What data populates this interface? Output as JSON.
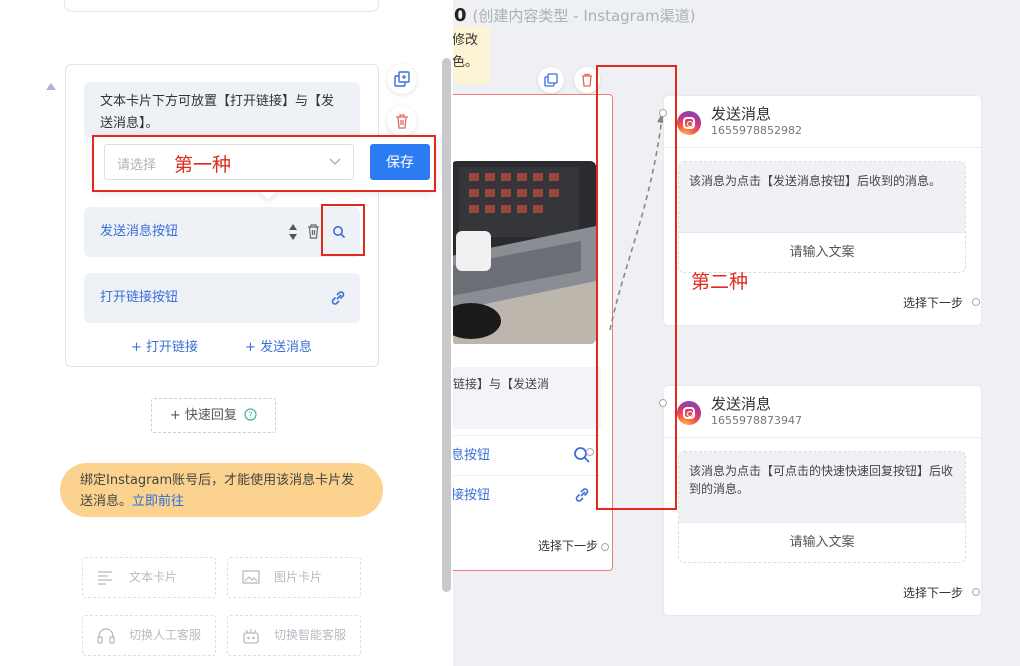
{
  "canvas": {
    "flow_number": "0",
    "flow_subtitle": "(创建内容类型 - Instagram渠道)",
    "note_lines": [
      "修改",
      "色。"
    ],
    "main_card": {
      "snippet": "开链接】与【发送消",
      "buttons": [
        {
          "label": "息按钮",
          "icon": "search-icon"
        },
        {
          "label": "接按钮",
          "icon": "link-icon"
        }
      ],
      "next_step": "选择下一步"
    },
    "nodes": [
      {
        "title": "发送消息",
        "id": "1655978852982",
        "message": "该消息为点击【发送消息按钮】后收到的消息。",
        "placeholder": "请输入文案",
        "next_step": "选择下一步"
      },
      {
        "title": "发送消息",
        "id": "1655978873947",
        "message": "该消息为点击【可点击的快速快速回复按钮】后收到的消息。",
        "placeholder": "请输入文案",
        "next_step": "选择下一步"
      }
    ],
    "annotation_second": "第二种"
  },
  "panel": {
    "text_card": "文本卡片下方可放置【打开链接】与【发送消息】。",
    "popover": {
      "select_placeholder": "请选择",
      "annotation_first": "第一种",
      "save_label": "保存"
    },
    "buttons": [
      {
        "label": "发送消息按钮",
        "icon": "search-icon"
      },
      {
        "label": "打开链接按钮",
        "icon": "link-icon"
      }
    ],
    "add_open_link": "+ 打开链接",
    "add_send_message": "+ 发送消息",
    "quick_reply": "+ 快速回复",
    "warning_text": "绑定Instagram账号后，才能使用该消息卡片发送消息。",
    "warning_link": "立即前往",
    "tools": [
      {
        "label": "文本卡片",
        "icon": "text-lines-icon"
      },
      {
        "label": "图片卡片",
        "icon": "image-icon"
      },
      {
        "label": "切换人工客服",
        "icon": "headset-icon"
      },
      {
        "label": "切换智能客服",
        "icon": "robot-icon"
      }
    ]
  },
  "colors": {
    "accent": "#2b7cf3",
    "annotation_red": "#e02a1c",
    "warning_bg": "#fbd28e",
    "canvas_bg": "#eef0f4"
  }
}
